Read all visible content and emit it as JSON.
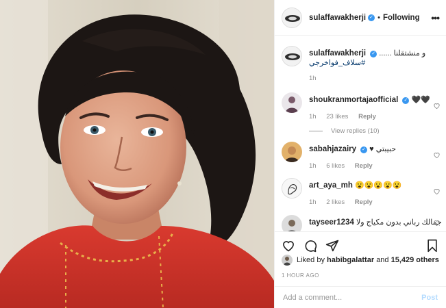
{
  "post": {
    "username": "sulaffawakherji",
    "follow_status": "Following",
    "more_glyph": "•••"
  },
  "caption": {
    "username": "sulaffawakherji",
    "text": "و منشتقلنا ......",
    "hashtag": "#سلاف_فواخرجي",
    "time": "1h"
  },
  "comments": [
    {
      "username": "shoukranmortajaofficial",
      "verified": true,
      "text": "🖤🖤",
      "time": "1h",
      "likes": "23 likes",
      "reply": "Reply",
      "view_replies": "View replies (10)"
    },
    {
      "username": "sabahjazairy",
      "verified": true,
      "text": "حبيبتي ♥",
      "time": "1h",
      "likes": "6 likes",
      "reply": "Reply"
    },
    {
      "username": "art_aya_mh",
      "verified": false,
      "text": "😮😮😮😮😮",
      "time": "1h",
      "likes": "2 likes",
      "reply": "Reply"
    },
    {
      "username": "tayseer1234",
      "verified": false,
      "text": "جمالك رباني بدون مكياج ولا",
      "time": "",
      "likes": "",
      "reply": ""
    }
  ],
  "likes_line": {
    "prefix": "Liked by",
    "user": "habibgalattar",
    "conj": "and",
    "count": "15,429 others"
  },
  "time_ago": "1 HOUR AGO",
  "add_comment": {
    "placeholder": "Add a comment...",
    "post_label": "Post"
  },
  "colors": {
    "verified": "#3897f0",
    "hashtag": "#003569",
    "post_button": "#b3dbff",
    "sweater": "#d9382e"
  },
  "icons": [
    "heart-icon",
    "comment-icon",
    "share-icon",
    "bookmark-icon",
    "more-icon",
    "verified-icon"
  ]
}
